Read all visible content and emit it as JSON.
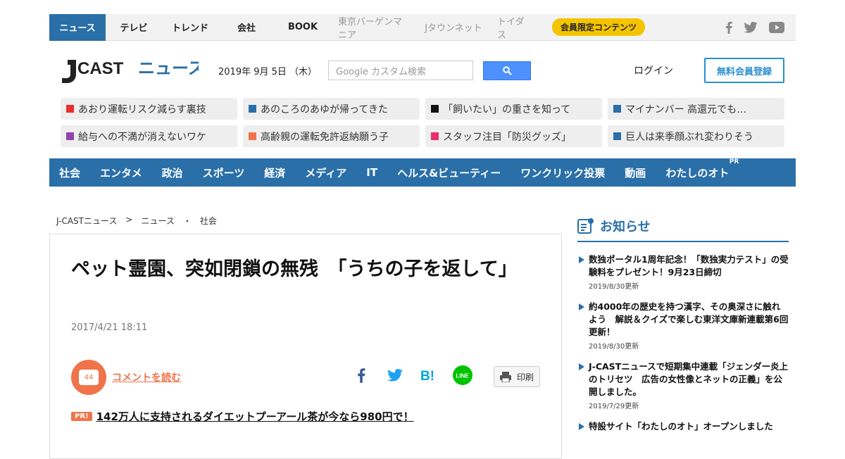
{
  "topnav": {
    "tabs": [
      "ニュース",
      "テレビ",
      "トレンド",
      "会社",
      "BOOK"
    ],
    "sub_sites": [
      "東京バーゲンマニア",
      "Jタウンネット",
      "トイダス"
    ],
    "member_badge": "会員限定コンテンツ",
    "social": [
      "facebook-icon",
      "twitter-icon",
      "youtube-icon"
    ]
  },
  "header": {
    "logo_text": "J-CAST ニュース",
    "date": "2019年 9月 5日 （木）",
    "search_placeholder": "Google カスタム検索",
    "login": "ログイン",
    "register": "無料会員登録"
  },
  "trending": [
    {
      "text": "あおり運転リスク減らす裏技",
      "color": "#e8302a"
    },
    {
      "text": "あのころのあゆが帰ってきた",
      "color": "#2a6fa8"
    },
    {
      "text": "「飼いたい」の重さを知って",
      "color": "#111111"
    },
    {
      "text": "マイナンバー 高還元でも…",
      "color": "#2a6fa8"
    },
    {
      "text": "給与への不満が消えないワケ",
      "color": "#8e44ad"
    },
    {
      "text": "高齢親の運転免許返納願う子",
      "color": "#f0734a"
    },
    {
      "text": "スタッフ注目「防災グッズ」",
      "color": "#e8306a"
    },
    {
      "text": "巨人は来季顔ぶれ変わりそう",
      "color": "#2a6fa8"
    }
  ],
  "categories": [
    "社会",
    "エンタメ",
    "政治",
    "スポーツ",
    "経済",
    "メディア",
    "IT",
    "ヘルス&ビューティー",
    "ワンクリック投票",
    "動画",
    "わたしのオト"
  ],
  "category_pr": "PR",
  "breadcrumb": [
    "J-CASTニュース",
    ">",
    "ニュース",
    "・",
    "社会"
  ],
  "article": {
    "title": "ペット霊園、突如閉鎖の無残　「うちの子を返して」",
    "date": "2017/4/21 18:11",
    "comment_count": "44",
    "comment_link": "コメントを読む",
    "print": "印刷",
    "ad_tag": "PR!",
    "ad_text": "142万人に支持されるダイエットプーアール茶が今なら980円で！"
  },
  "sidebar": {
    "title": "お知らせ",
    "news": [
      {
        "headline": "数独ポータル1周年記念！「数独実力テスト」の受験料をプレゼント！9月23日締切",
        "date": "2019/8/30更新"
      },
      {
        "headline": "約4000年の歴史を持つ漢字、その奥深さに触れよう　解説＆クイズで楽しむ東洋文庫新連載第6回更新！",
        "date": "2019/8/30更新"
      },
      {
        "headline": "J-CASTニュースで短期集中連載「ジェンダー炎上のトリセツ　広告の女性像とネットの正義」を公開しました。",
        "date": "2019/7/29更新"
      },
      {
        "headline": "特設サイト「わたしのオト」オープンしました",
        "date": ""
      }
    ]
  }
}
